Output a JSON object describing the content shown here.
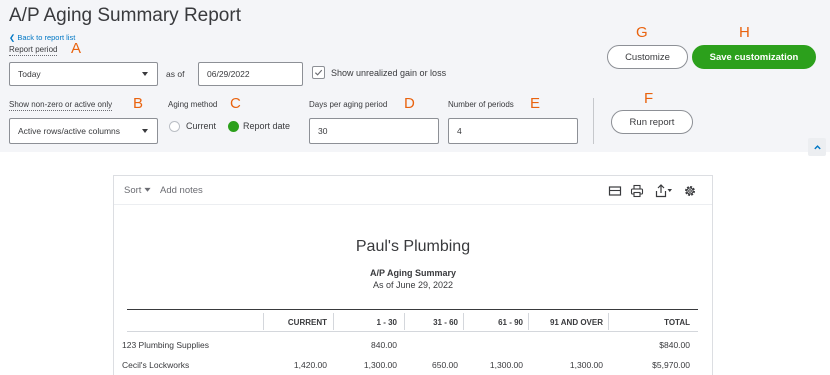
{
  "header": {
    "title": "A/P Aging Summary Report",
    "back_link": "❮ Back to report list"
  },
  "callouts": {
    "a": "A",
    "b": "B",
    "c": "C",
    "d": "D",
    "e": "E",
    "f": "F",
    "g": "G",
    "h": "H"
  },
  "filters": {
    "report_period_label": "Report period",
    "report_period_value": "Today",
    "as_of_label": "as of",
    "as_of_value": "06/29/2022",
    "unrealized_label": "Show unrealized gain or loss",
    "show_nonzero_label": "Show non-zero or active only",
    "show_nonzero_value": "Active rows/active columns",
    "aging_method_label": "Aging method",
    "aging_current": "Current",
    "aging_report_date": "Report date",
    "days_label": "Days per aging period",
    "days_value": "30",
    "periods_label": "Number of periods",
    "periods_value": "4"
  },
  "buttons": {
    "customize": "Customize",
    "save_customization": "Save customization",
    "run_report": "Run report"
  },
  "report": {
    "sort_label": "Sort",
    "add_notes": "Add notes",
    "company": "Paul's Plumbing",
    "title": "A/P Aging Summary",
    "subtitle": "As of June 29, 2022",
    "columns": [
      "CURRENT",
      "1 - 30",
      "31 - 60",
      "61 - 90",
      "91 AND OVER",
      "TOTAL"
    ],
    "rows": [
      {
        "name": "123 Plumbing Supplies",
        "cells": [
          "",
          "840.00",
          "",
          "",
          "",
          "$840.00"
        ]
      },
      {
        "name": "Cecil's Lockworks",
        "cells": [
          "1,420.00",
          "1,300.00",
          "650.00",
          "1,300.00",
          "1,300.00",
          "$5,970.00"
        ]
      }
    ]
  },
  "colors": {
    "accent_green": "#2ca01c",
    "callout_orange": "#e9630f",
    "link_blue": "#0077c5"
  },
  "icons": [
    "chevron-left-icon",
    "dropdown-caret-icon",
    "checkmark-icon",
    "chevron-up-icon",
    "sort-caret-icon",
    "email-icon",
    "print-icon",
    "export-icon",
    "gear-icon"
  ]
}
